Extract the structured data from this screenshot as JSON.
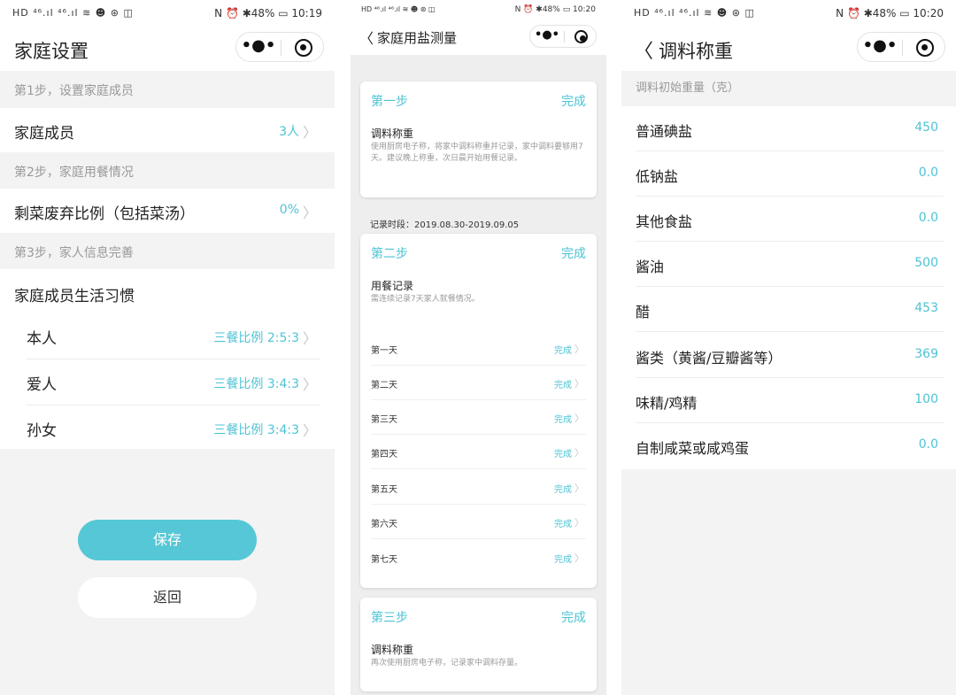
{
  "screens": [
    {
      "status": {
        "left": "HD ⁴⁶.ıl ⁴⁶.ıl ≋ ☻ ⊛ ◫",
        "right": "N ⏰ ✱48% ▭ 10:19"
      },
      "title": "家庭设置",
      "step1": {
        "header": "第1步，设置家庭成员",
        "label": "家庭成员",
        "value": "3人"
      },
      "step2": {
        "header": "第2步，家庭用餐情况",
        "label": "剩菜废弃比例（包括菜汤）",
        "value": "0%"
      },
      "step3": {
        "header": "第3步，家人信息完善",
        "label": "家庭成员生活习惯",
        "members": [
          {
            "name": "本人",
            "value": "三餐比例 2:5:3"
          },
          {
            "name": "爱人",
            "value": "三餐比例 3:4:3"
          },
          {
            "name": "孙女",
            "value": "三餐比例 3:4:3"
          }
        ]
      },
      "save_label": "保存",
      "back_label": "返回"
    },
    {
      "status": {
        "left": "HD ⁴⁶.ıl ⁴⁶.ıl ≋ ☻ ⊛ ◫",
        "right": "N ⏰ ✱48% ▭ 10:20"
      },
      "title": "家庭用盐测量",
      "card1": {
        "step": "第一步",
        "status": "完成",
        "title": "调料称重",
        "desc": "使用厨房电子称，将家中调料称重并记录，家中调料要够用7天。建议晚上称重，次日晨开始用餐记录。"
      },
      "period": "记录时段：2019.08.30-2019.09.05",
      "card2": {
        "step": "第二步",
        "status": "完成",
        "title": "用餐记录",
        "desc": "需连续记录7天家人就餐情况。",
        "days": [
          {
            "day": "第一天",
            "status": "完成"
          },
          {
            "day": "第二天",
            "status": "完成"
          },
          {
            "day": "第三天",
            "status": "完成"
          },
          {
            "day": "第四天",
            "status": "完成"
          },
          {
            "day": "第五天",
            "status": "完成"
          },
          {
            "day": "第六天",
            "status": "完成"
          },
          {
            "day": "第七天",
            "status": "完成"
          }
        ]
      },
      "card3": {
        "step": "第三步",
        "status": "完成",
        "title": "调料称重",
        "desc": "再次使用厨房电子称，记录家中调料存量。"
      }
    },
    {
      "status": {
        "left": "HD ⁴⁶.ıl ⁴⁶.ıl ≋ ☻ ⊛ ◫",
        "right": "N ⏰ ✱48% ▭ 10:20"
      },
      "title": "调料称重",
      "section": "调料初始重量（克）",
      "items": [
        {
          "name": "普通碘盐",
          "value": "450"
        },
        {
          "name": "低钠盐",
          "value": "0.0"
        },
        {
          "name": "其他食盐",
          "value": "0.0"
        },
        {
          "name": "酱油",
          "value": "500"
        },
        {
          "name": "醋",
          "value": "453"
        },
        {
          "name": "酱类（黄酱/豆瓣酱等）",
          "value": "369"
        },
        {
          "name": "味精/鸡精",
          "value": "100"
        },
        {
          "name": "自制咸菜或咸鸡蛋",
          "value": "0.0"
        }
      ]
    }
  ],
  "capsule": {
    "more": "•●•",
    "chevron_right": "〉",
    "back": "〈"
  }
}
